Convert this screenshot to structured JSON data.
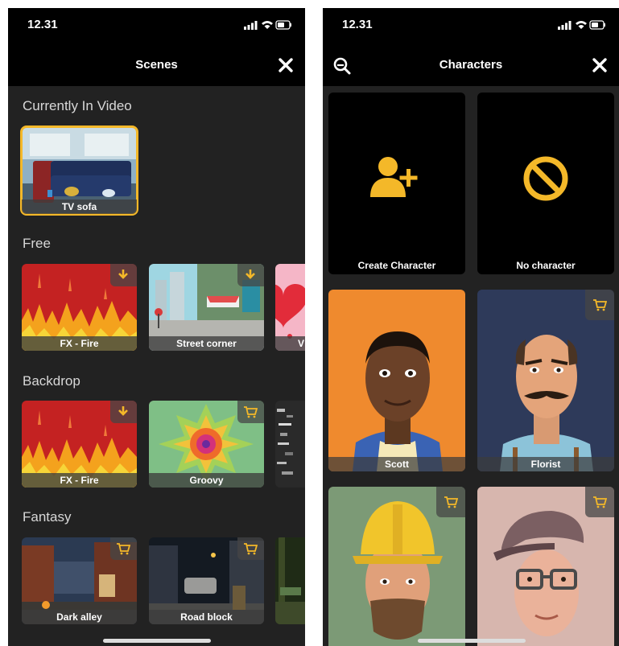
{
  "status_time": "12.31",
  "colors": {
    "accent": "#f4b829",
    "background": "#222222",
    "bar": "#000000"
  },
  "scenes": {
    "title": "Scenes",
    "close_icon": "close-icon",
    "sections": {
      "current": {
        "heading": "Currently In Video",
        "items": [
          {
            "label": "TV sofa",
            "selected": true
          }
        ]
      },
      "free": {
        "heading": "Free",
        "items": [
          {
            "label": "FX - Fire",
            "badge": "download-icon"
          },
          {
            "label": "Street corner",
            "badge": "download-icon"
          },
          {
            "label": "V",
            "badge": ""
          }
        ]
      },
      "backdrop": {
        "heading": "Backdrop",
        "items": [
          {
            "label": "FX - Fire",
            "badge": "download-icon"
          },
          {
            "label": "Groovy",
            "badge": "cart-icon"
          }
        ]
      },
      "fantasy": {
        "heading": "Fantasy",
        "items": [
          {
            "label": "Dark alley",
            "badge": "cart-icon"
          },
          {
            "label": "Road block",
            "badge": "cart-icon"
          }
        ]
      }
    }
  },
  "characters": {
    "title": "Characters",
    "search_icon": "search-icon",
    "close_icon": "close-icon",
    "tiles": [
      {
        "label": "Create Character",
        "icon": "add-person-icon"
      },
      {
        "label": "No character",
        "icon": "no-entry-icon"
      },
      {
        "label": "Scott",
        "badge": ""
      },
      {
        "label": "Florist",
        "badge": "cart-icon"
      },
      {
        "label": "",
        "badge": "cart-icon"
      },
      {
        "label": "",
        "badge": "cart-icon"
      }
    ]
  }
}
